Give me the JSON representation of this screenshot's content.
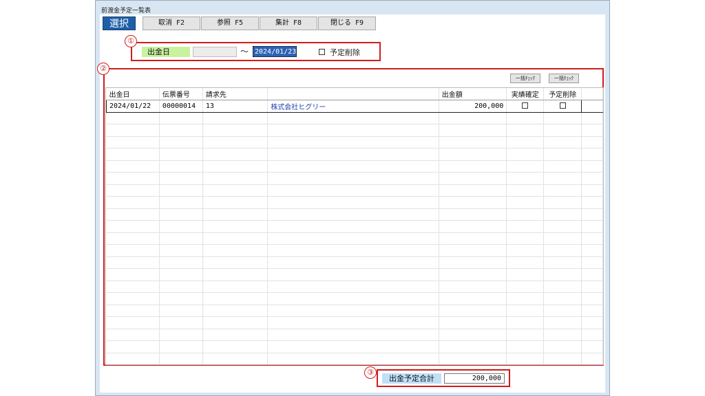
{
  "window": {
    "title": "前渡金予定一覧表"
  },
  "toolbar": {
    "select": "選択",
    "buttons": [
      "取消 F2",
      "参照 F5",
      "集計 F8",
      "閉じる F9"
    ]
  },
  "filter": {
    "label": "出金日",
    "date_from": "",
    "tilde": "〜",
    "date_to": "2024/01/23",
    "delete_label": "予定削除"
  },
  "bulk_check": [
    "一括ﾁｪｯｸ",
    "一括ﾁｪｯｸ"
  ],
  "table": {
    "headers": [
      "出金日",
      "伝票番号",
      "請求先",
      "",
      "出金額",
      "実績確定",
      "予定削除"
    ],
    "rows": [
      {
        "date": "2024/01/22",
        "slip": "00000014",
        "code": "13",
        "name": "株式会社ヒグリー",
        "amount": "200,000"
      }
    ]
  },
  "summary": {
    "label": "出金予定合計",
    "value": "200,000"
  },
  "annotations": [
    "①",
    "②",
    "③"
  ]
}
